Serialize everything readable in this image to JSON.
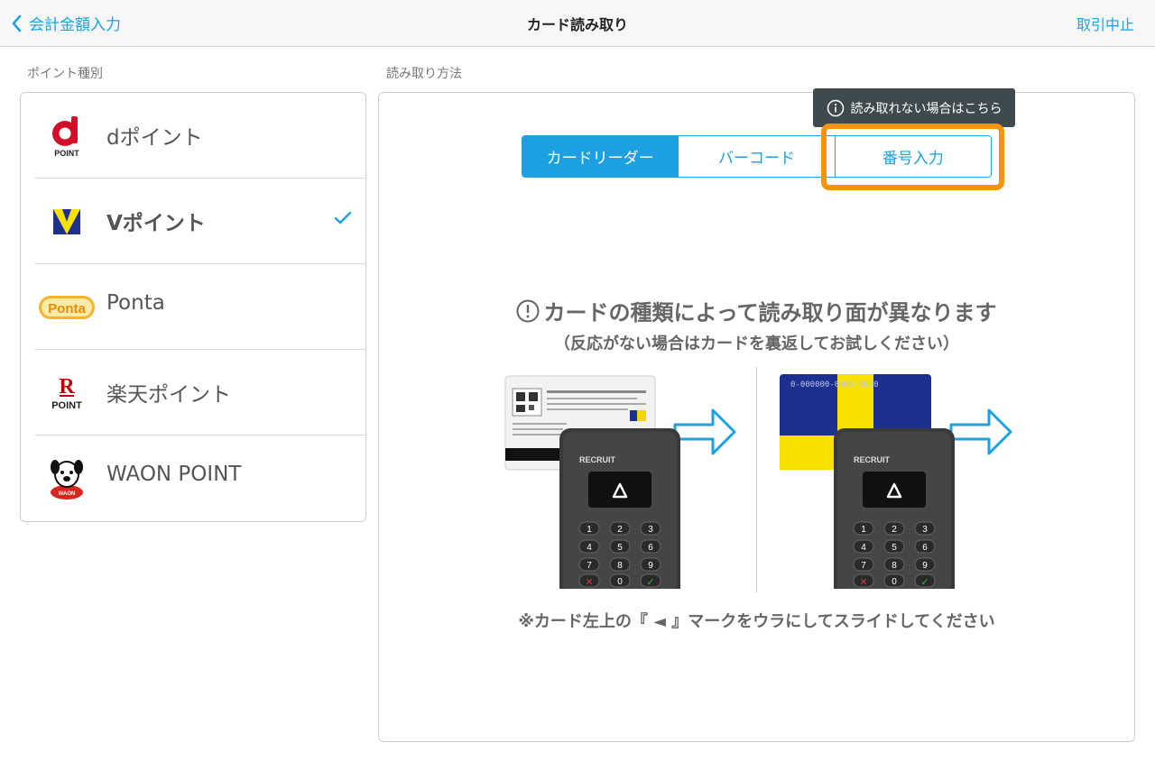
{
  "header": {
    "back_label": "会計金額入力",
    "title": "カード読み取り",
    "cancel_label": "取引中止"
  },
  "left": {
    "section_label": "ポイント種別",
    "items": [
      {
        "label": "dポイント",
        "logo": "d-point-logo",
        "logo_text": "POINT",
        "selected": false
      },
      {
        "label": "Vポイント",
        "logo": "v-point-logo",
        "selected": true
      },
      {
        "label": "Ponta",
        "logo": "ponta-logo",
        "logo_text": "Ponta",
        "selected": false
      },
      {
        "label": "楽天ポイント",
        "logo": "rakuten-point-logo",
        "logo_text": "POINT",
        "selected": false
      },
      {
        "label": "WAON POINT",
        "logo": "waon-point-logo",
        "logo_text": "WAON",
        "selected": false
      }
    ]
  },
  "right": {
    "section_label": "読み取り方法",
    "tooltip": "読み取れない場合はこちら",
    "segments": [
      {
        "label": "カードリーダー",
        "active": true
      },
      {
        "label": "バーコード",
        "active": false
      },
      {
        "label": "番号入力",
        "active": false
      }
    ],
    "notice_title": "カードの種類によって読み取り面が異なります",
    "notice_sub": "（反応がない場合はカードを裏返してお試しください）",
    "footnote": "※カード左上の『 ◄ 』マークをウラにしてスライドしてください",
    "reader_brand": "RECRUIT",
    "card_number": "0-000000-0000-0000"
  },
  "colors": {
    "accent": "#1ba1e2",
    "highlight": "#f7930a",
    "tooltip_bg": "#3e4a4d"
  }
}
